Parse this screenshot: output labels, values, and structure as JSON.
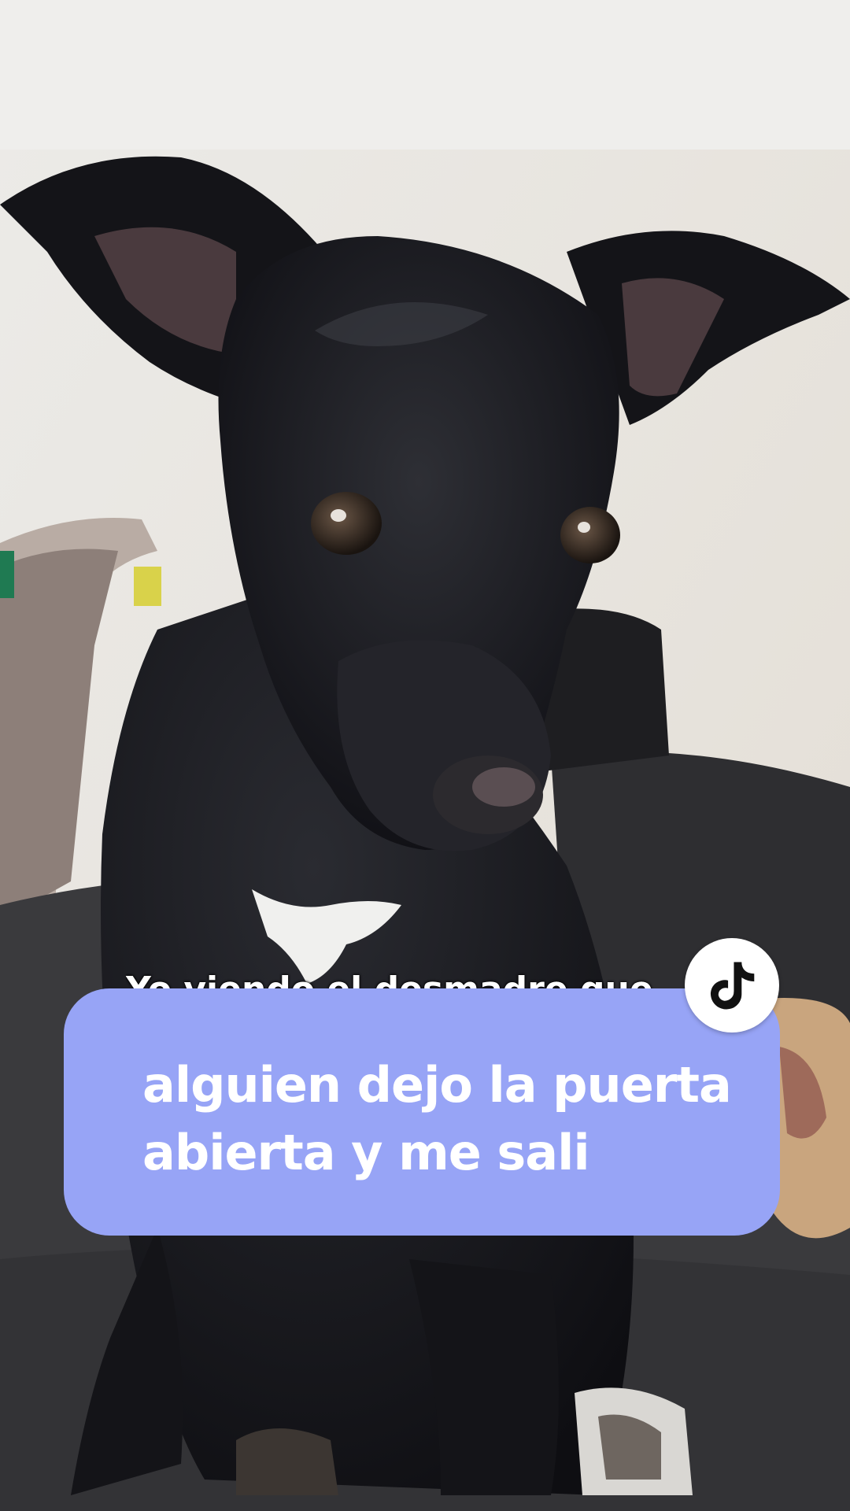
{
  "overlay_card": {
    "lines": [
      "alguien dejo la puerta",
      "abierta y me sali"
    ],
    "background": "#97a4f6",
    "text_color": "#ffffff"
  },
  "back_caption": {
    "text": "Yo viendo el desmadre que"
  },
  "logo": {
    "icon": "tiktok-logo-icon",
    "badge_color": "#ffffff",
    "mark_color": "#111111"
  }
}
